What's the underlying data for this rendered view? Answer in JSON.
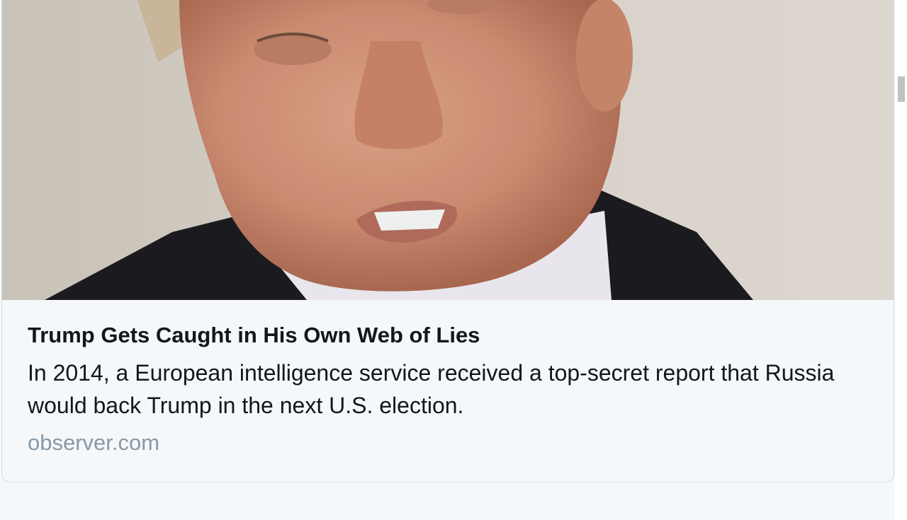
{
  "card": {
    "title": "Trump Gets Caught in His Own Web of Lies",
    "description": "In 2014, a European intelligence service received a top-secret report that Russia would back Trump in the next U.S. election.",
    "domain": "observer.com"
  },
  "image": {
    "subject": "portrait-photo"
  },
  "colors": {
    "background": "#f5f8fa",
    "title": "#14171a",
    "domain": "#8899a6",
    "border": "#d3dce3"
  }
}
